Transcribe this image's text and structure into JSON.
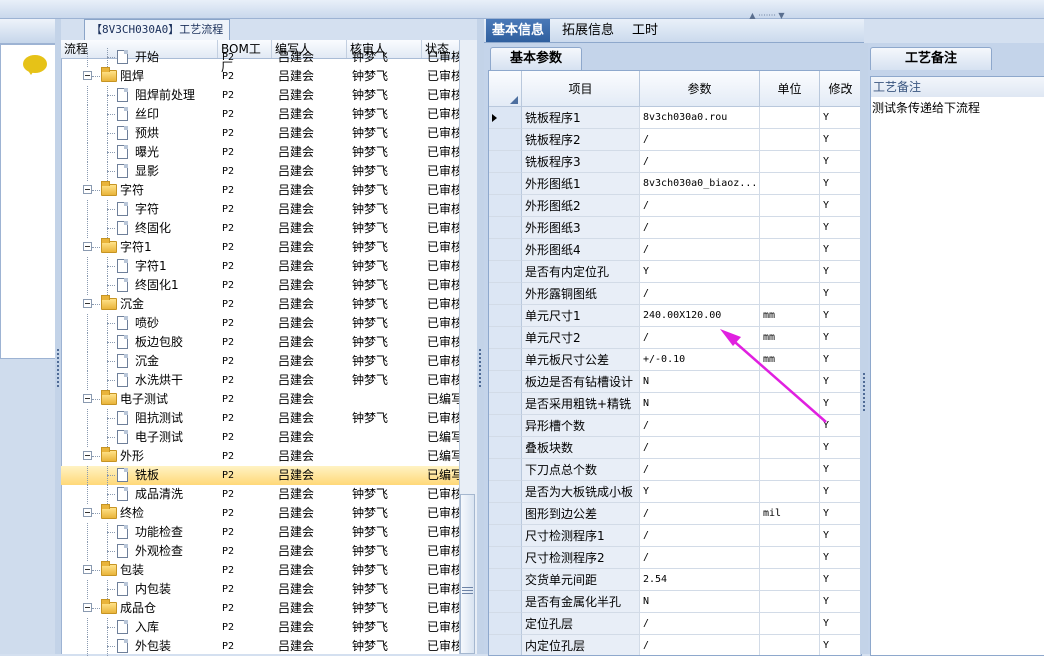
{
  "tree": {
    "title": "【8V3CH030A0】工艺流程",
    "columns": [
      "流程",
      "BOM工厂",
      "编写人",
      "核审人",
      "状态"
    ],
    "rows": [
      {
        "level": 1,
        "kind": "doc",
        "name": "开始",
        "factory": "P2",
        "writer": "吕建会",
        "reviewer": "钟梦飞",
        "status": "已审核"
      },
      {
        "level": 0,
        "kind": "folder",
        "name": "阻焊",
        "factory": "P2",
        "writer": "吕建会",
        "reviewer": "钟梦飞",
        "status": "已审核"
      },
      {
        "level": 1,
        "kind": "doc",
        "name": "阻焊前处理",
        "factory": "P2",
        "writer": "吕建会",
        "reviewer": "钟梦飞",
        "status": "已审核"
      },
      {
        "level": 1,
        "kind": "doc",
        "name": "丝印",
        "factory": "P2",
        "writer": "吕建会",
        "reviewer": "钟梦飞",
        "status": "已审核"
      },
      {
        "level": 1,
        "kind": "doc",
        "name": "预烘",
        "factory": "P2",
        "writer": "吕建会",
        "reviewer": "钟梦飞",
        "status": "已审核"
      },
      {
        "level": 1,
        "kind": "doc",
        "name": "曝光",
        "factory": "P2",
        "writer": "吕建会",
        "reviewer": "钟梦飞",
        "status": "已审核"
      },
      {
        "level": 1,
        "kind": "doc",
        "name": "显影",
        "factory": "P2",
        "writer": "吕建会",
        "reviewer": "钟梦飞",
        "status": "已审核"
      },
      {
        "level": 0,
        "kind": "folder",
        "name": "字符",
        "factory": "P2",
        "writer": "吕建会",
        "reviewer": "钟梦飞",
        "status": "已审核"
      },
      {
        "level": 1,
        "kind": "doc",
        "name": "字符",
        "factory": "P2",
        "writer": "吕建会",
        "reviewer": "钟梦飞",
        "status": "已审核"
      },
      {
        "level": 1,
        "kind": "doc",
        "name": "终固化",
        "factory": "P2",
        "writer": "吕建会",
        "reviewer": "钟梦飞",
        "status": "已审核"
      },
      {
        "level": 0,
        "kind": "folder",
        "name": "字符1",
        "factory": "P2",
        "writer": "吕建会",
        "reviewer": "钟梦飞",
        "status": "已审核"
      },
      {
        "level": 1,
        "kind": "doc",
        "name": "字符1",
        "factory": "P2",
        "writer": "吕建会",
        "reviewer": "钟梦飞",
        "status": "已审核"
      },
      {
        "level": 1,
        "kind": "doc",
        "name": "终固化1",
        "factory": "P2",
        "writer": "吕建会",
        "reviewer": "钟梦飞",
        "status": "已审核"
      },
      {
        "level": 0,
        "kind": "folder",
        "name": "沉金",
        "factory": "P2",
        "writer": "吕建会",
        "reviewer": "钟梦飞",
        "status": "已审核"
      },
      {
        "level": 1,
        "kind": "doc",
        "name": "喷砂",
        "factory": "P2",
        "writer": "吕建会",
        "reviewer": "钟梦飞",
        "status": "已审核"
      },
      {
        "level": 1,
        "kind": "doc",
        "name": "板边包胶",
        "factory": "P2",
        "writer": "吕建会",
        "reviewer": "钟梦飞",
        "status": "已审核"
      },
      {
        "level": 1,
        "kind": "doc",
        "name": "沉金",
        "factory": "P2",
        "writer": "吕建会",
        "reviewer": "钟梦飞",
        "status": "已审核"
      },
      {
        "level": 1,
        "kind": "doc",
        "name": "水洗烘干",
        "factory": "P2",
        "writer": "吕建会",
        "reviewer": "钟梦飞",
        "status": "已审核"
      },
      {
        "level": 0,
        "kind": "folder",
        "name": "电子测试",
        "factory": "P2",
        "writer": "吕建会",
        "reviewer": "",
        "status": "已编写"
      },
      {
        "level": 1,
        "kind": "doc",
        "name": "阻抗测试",
        "factory": "P2",
        "writer": "吕建会",
        "reviewer": "钟梦飞",
        "status": "已审核"
      },
      {
        "level": 1,
        "kind": "doc",
        "name": "电子测试",
        "factory": "P2",
        "writer": "吕建会",
        "reviewer": "",
        "status": "已编写"
      },
      {
        "level": 0,
        "kind": "folder",
        "name": "外形",
        "factory": "P2",
        "writer": "吕建会",
        "reviewer": "",
        "status": "已编写"
      },
      {
        "level": 1,
        "kind": "doc",
        "name": "铣板",
        "factory": "P2",
        "writer": "吕建会",
        "reviewer": "",
        "status": "已编写",
        "selected": true
      },
      {
        "level": 1,
        "kind": "doc",
        "name": "成品清洗",
        "factory": "P2",
        "writer": "吕建会",
        "reviewer": "钟梦飞",
        "status": "已审核"
      },
      {
        "level": 0,
        "kind": "folder",
        "name": "终检",
        "factory": "P2",
        "writer": "吕建会",
        "reviewer": "钟梦飞",
        "status": "已审核"
      },
      {
        "level": 1,
        "kind": "doc",
        "name": "功能检查",
        "factory": "P2",
        "writer": "吕建会",
        "reviewer": "钟梦飞",
        "status": "已审核"
      },
      {
        "level": 1,
        "kind": "doc",
        "name": "外观检查",
        "factory": "P2",
        "writer": "吕建会",
        "reviewer": "钟梦飞",
        "status": "已审核"
      },
      {
        "level": 0,
        "kind": "folder",
        "name": "包装",
        "factory": "P2",
        "writer": "吕建会",
        "reviewer": "钟梦飞",
        "status": "已审核"
      },
      {
        "level": 1,
        "kind": "doc",
        "name": "内包装",
        "factory": "P2",
        "writer": "吕建会",
        "reviewer": "钟梦飞",
        "status": "已审核"
      },
      {
        "level": 0,
        "kind": "folder",
        "name": "成品仓",
        "factory": "P2",
        "writer": "吕建会",
        "reviewer": "钟梦飞",
        "status": "已审核"
      },
      {
        "level": 1,
        "kind": "doc",
        "name": "入库",
        "factory": "P2",
        "writer": "吕建会",
        "reviewer": "钟梦飞",
        "status": "已审核"
      },
      {
        "level": 1,
        "kind": "doc",
        "name": "外包装",
        "factory": "P2",
        "writer": "吕建会",
        "reviewer": "钟梦飞",
        "status": "已审核"
      }
    ]
  },
  "center": {
    "tabs": [
      "基本信息",
      "拓展信息",
      "工时"
    ],
    "active_tab": 0,
    "subtab": "基本参数",
    "columns": [
      "项目",
      "参数",
      "单位",
      "修改"
    ],
    "rows": [
      {
        "item": "铣板程序1",
        "param": "8v3ch030a0.rou",
        "unit": "",
        "mod": "Y",
        "current": true
      },
      {
        "item": "铣板程序2",
        "param": "/",
        "unit": "",
        "mod": "Y"
      },
      {
        "item": "铣板程序3",
        "param": "/",
        "unit": "",
        "mod": "Y"
      },
      {
        "item": "外形图纸1",
        "param": "8v3ch030a0_biaoz...",
        "unit": "",
        "mod": "Y"
      },
      {
        "item": "外形图纸2",
        "param": "/",
        "unit": "",
        "mod": "Y"
      },
      {
        "item": "外形图纸3",
        "param": "/",
        "unit": "",
        "mod": "Y"
      },
      {
        "item": "外形图纸4",
        "param": "/",
        "unit": "",
        "mod": "Y"
      },
      {
        "item": "是否有内定位孔",
        "param": "Y",
        "unit": "",
        "mod": "Y"
      },
      {
        "item": "外形露铜图纸",
        "param": "/",
        "unit": "",
        "mod": "Y"
      },
      {
        "item": "单元尺寸1",
        "param": "240.00X120.00",
        "unit": "mm",
        "mod": "Y"
      },
      {
        "item": "单元尺寸2",
        "param": "/",
        "unit": "mm",
        "mod": "Y"
      },
      {
        "item": "单元板尺寸公差",
        "param": "+/-0.10",
        "unit": "mm",
        "mod": "Y"
      },
      {
        "item": "板边是否有钻槽设计",
        "param": "N",
        "unit": "",
        "mod": "Y"
      },
      {
        "item": "是否采用粗铣+精铣",
        "param": "N",
        "unit": "",
        "mod": "Y"
      },
      {
        "item": "异形槽个数",
        "param": "/",
        "unit": "",
        "mod": "Y"
      },
      {
        "item": "叠板块数",
        "param": "/",
        "unit": "",
        "mod": "Y"
      },
      {
        "item": "下刀点总个数",
        "param": "/",
        "unit": "",
        "mod": "Y"
      },
      {
        "item": "是否为大板铣成小板",
        "param": "Y",
        "unit": "",
        "mod": "Y"
      },
      {
        "item": "图形到边公差",
        "param": "/",
        "unit": "mil",
        "mod": "Y"
      },
      {
        "item": "尺寸检测程序1",
        "param": "/",
        "unit": "",
        "mod": "Y"
      },
      {
        "item": "尺寸检测程序2",
        "param": "/",
        "unit": "",
        "mod": "Y"
      },
      {
        "item": "交货单元间距",
        "param": "2.54",
        "unit": "",
        "mod": "Y"
      },
      {
        "item": "是否有金属化半孔",
        "param": "N",
        "unit": "",
        "mod": "Y"
      },
      {
        "item": "定位孔层",
        "param": "/",
        "unit": "",
        "mod": "Y"
      },
      {
        "item": "内定位孔层",
        "param": "/",
        "unit": "",
        "mod": "Y"
      }
    ]
  },
  "notes": {
    "tab": "工艺备注",
    "title": "工艺备注",
    "text": "测试条传递给下流程"
  },
  "colors": {
    "accent": "#2f5f9e",
    "arrow": "#e020e0",
    "selected_row": "#ffd878"
  }
}
